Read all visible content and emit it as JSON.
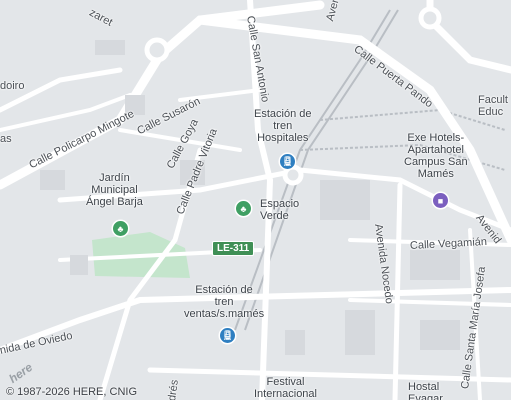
{
  "colors": {
    "background": "#e3e6e9",
    "road": "#ffffff",
    "park": "#c4e5cc",
    "rail": "#b9bec4",
    "transit_pin": "#2f7fc1",
    "park_pin": "#3f9f63",
    "hotel_pin": "#7b5fbf",
    "route_badge": "#3f8f55"
  },
  "streets": {
    "policarpo_mingote": "Calle Policarpo Mingote",
    "susaron": "Calle Susarón",
    "goya": "Calle Goya",
    "padre_vitoria": "Calle Padre Vitoria",
    "san_antonio": "Calle San Antonio",
    "puerta_pando": "Calle Puerta Pando",
    "avenida_top": "Avenida",
    "avenida_nocedo": "Avenida Nocedo",
    "vegamian": "Calle Vegamián",
    "santa_maria_josefa": "Calle Santa María Josefa",
    "oviedo": "nida de Oviedo",
    "andres": "drés",
    "avenida_right": "Avenid",
    "zaret": "zaret",
    "oiro": "doiro",
    "as": "as",
    "facult": "Facult\nEduc"
  },
  "pois": {
    "estacion_hospitales": "Estación de\ntren\nHospitales",
    "exe_hotels": "Exe Hotels-\nApartahotel\nCampus San\nMamés",
    "jardin": "Jardín\nMunicipal\nÁngel Barja",
    "espacio_verde": "Espacio\nVerde",
    "estacion_ventas": "Estación de\ntren\nventas/s.mamés",
    "festival": "Festival\nInternacional",
    "hostal": "Hostal\nEvagar"
  },
  "route": {
    "label": "LE-311"
  },
  "icons": {
    "transit": "train-icon",
    "park": "park-icon",
    "hotel": "hotel-icon"
  },
  "brand": {
    "logo": "here"
  },
  "copyright": "© 1987-2026 HERE, CNIG"
}
